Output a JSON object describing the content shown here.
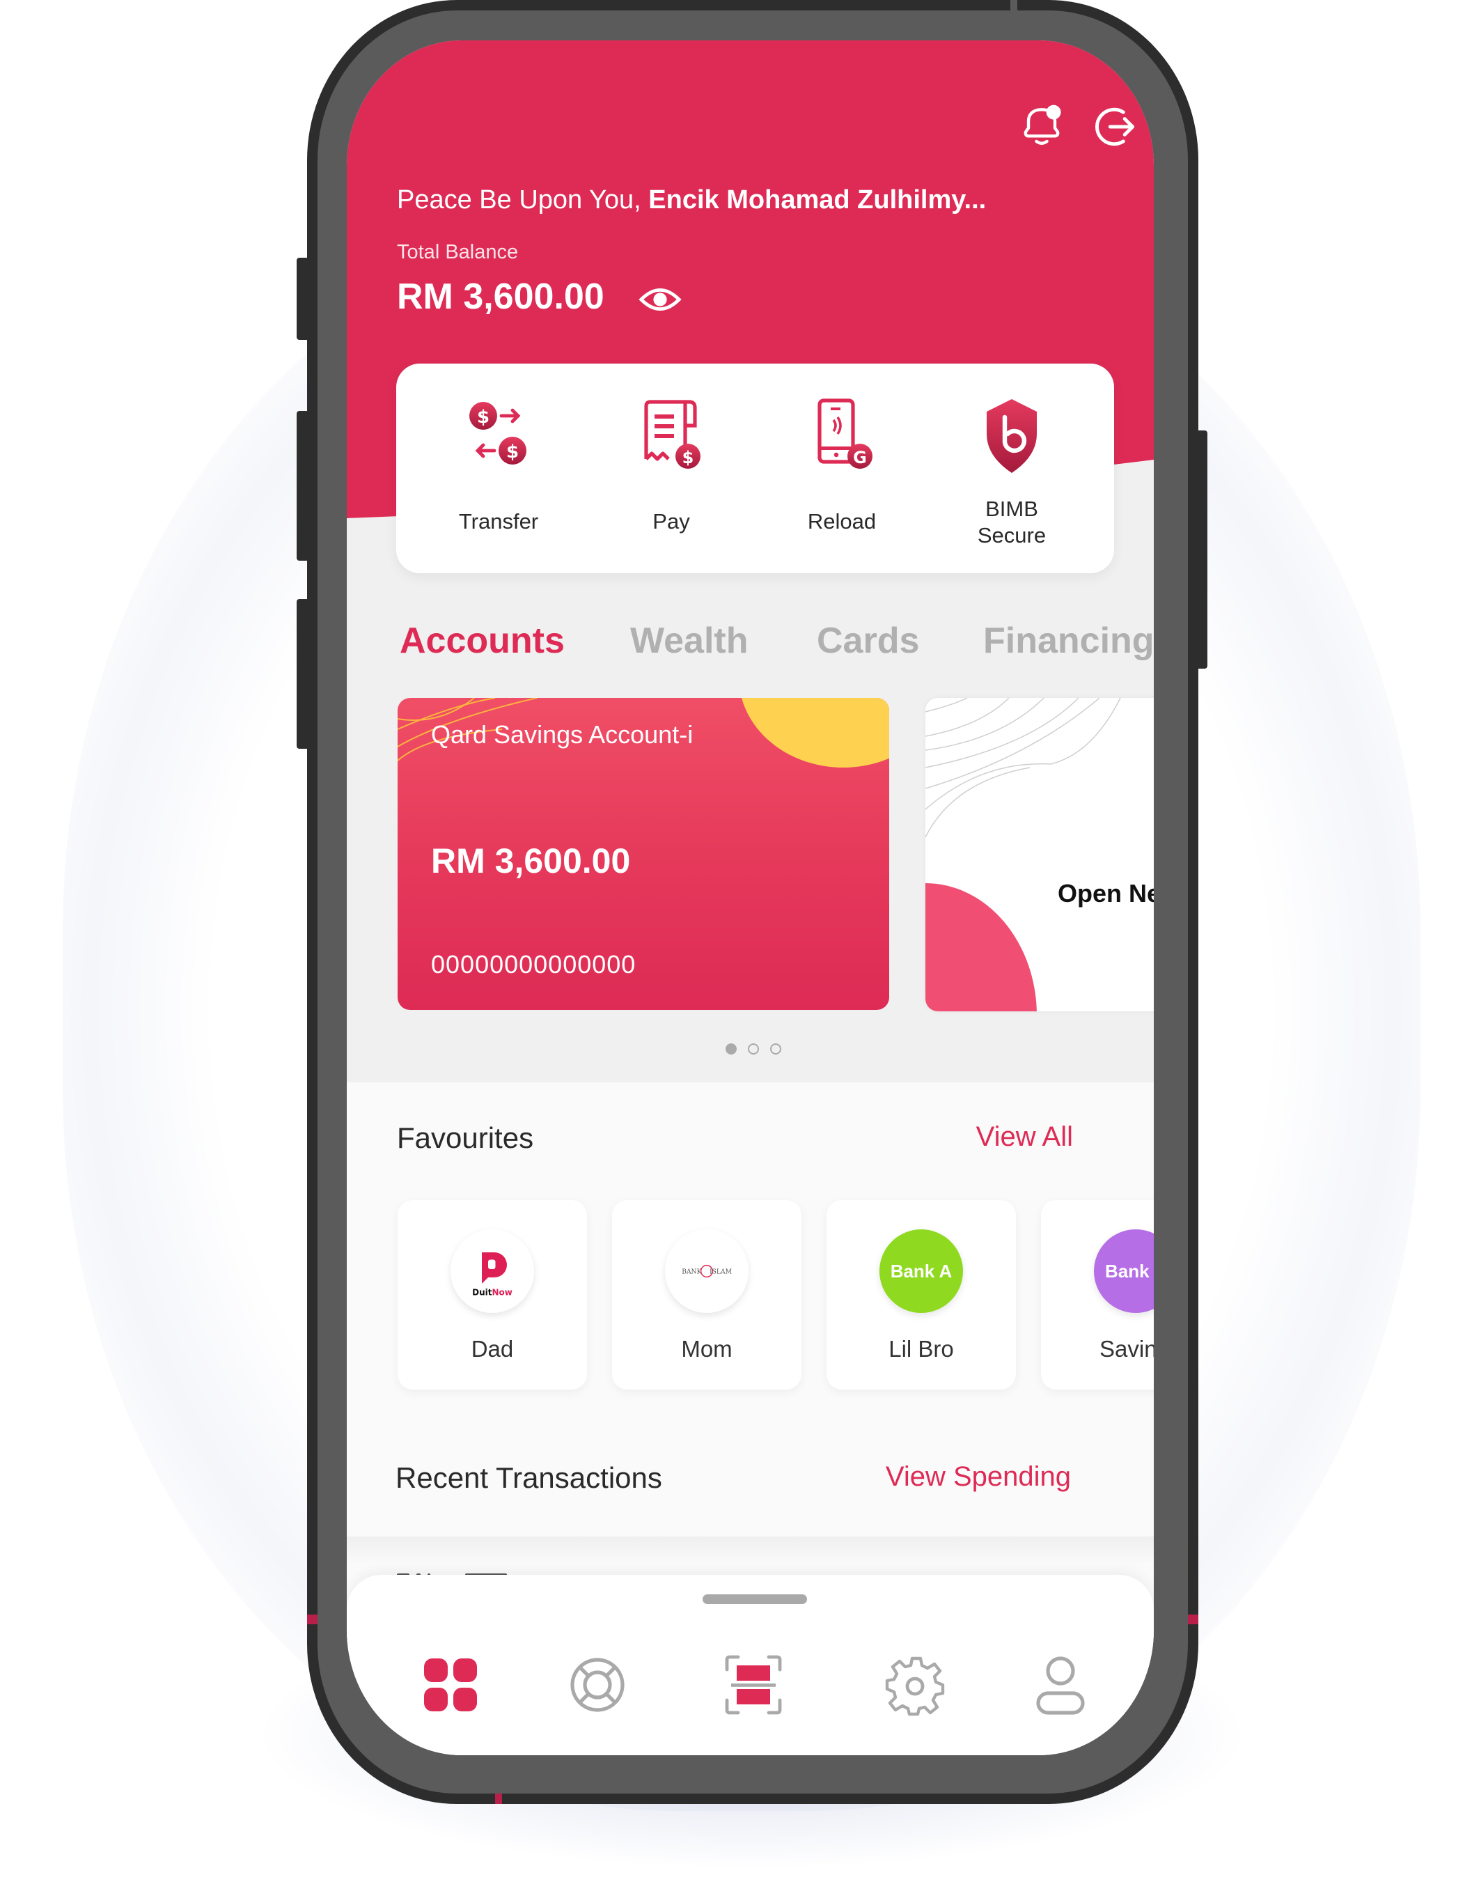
{
  "header": {
    "greeting_prefix": "Peace Be Upon You, ",
    "greeting_name": "Encik Mohamad Zulhilmy...",
    "balance_label": "Total Balance",
    "balance_value": "RM 3,600.00",
    "icons": [
      "bell-icon",
      "logout-icon",
      "eye-icon"
    ]
  },
  "quick_actions": [
    {
      "label": "Transfer",
      "icon": "transfer-icon"
    },
    {
      "label": "Pay",
      "icon": "pay-bill-icon"
    },
    {
      "label": "Reload",
      "icon": "reload-phone-icon"
    },
    {
      "label": "BIMB\nSecure",
      "icon": "bimb-secure-shield-icon"
    }
  ],
  "tabs": [
    {
      "label": "Accounts",
      "active": true
    },
    {
      "label": "Wealth",
      "active": false
    },
    {
      "label": "Cards",
      "active": false
    },
    {
      "label": "Financing",
      "active": false
    }
  ],
  "accounts": {
    "cards": [
      {
        "name": "Qard Savings Account-i",
        "balance": "RM 3,600.00",
        "number": "00000000000000"
      },
      {
        "label": "Open Ne"
      }
    ],
    "pagination": {
      "total": 3,
      "current": 1
    }
  },
  "favourites": {
    "title": "Favourites",
    "view_all": "View All",
    "items": [
      {
        "name": "Dad",
        "logo": "DuitNow",
        "logo_text_a": "Duit",
        "logo_text_b": "Now"
      },
      {
        "name": "Mom",
        "logo": "Bank Islam",
        "logo_text_a": "BANK",
        "logo_text_b": "ISLAM"
      },
      {
        "name": "Lil Bro",
        "logo": "Bank A",
        "color": "#8fd920"
      },
      {
        "name": "Savin",
        "logo": "Bank",
        "color": "#b56ee6"
      }
    ]
  },
  "transactions": {
    "title": "Recent Transactions",
    "view_spending": "View Spending"
  },
  "bottom_nav": [
    {
      "name": "home",
      "icon": "dashboard-grid-icon",
      "active": true
    },
    {
      "name": "help",
      "icon": "lifebuoy-icon",
      "active": false
    },
    {
      "name": "scan",
      "icon": "qr-scan-icon",
      "active": false
    },
    {
      "name": "settings",
      "icon": "gear-icon",
      "active": false
    },
    {
      "name": "profile",
      "icon": "user-icon",
      "active": false
    }
  ],
  "colors": {
    "brand": "#dd2b55",
    "yellow": "#fed150",
    "inactive": "#a9a9a9"
  }
}
